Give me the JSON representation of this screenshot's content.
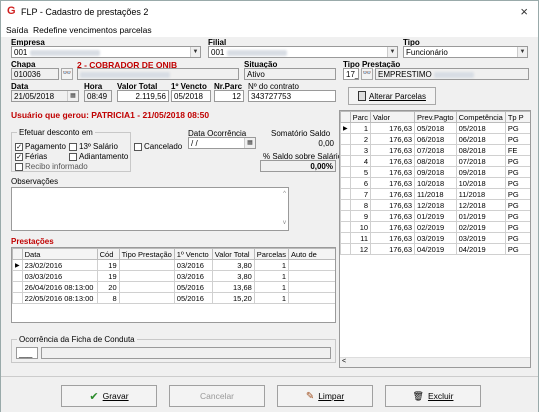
{
  "window": {
    "title": "FLP - Cadastro de prestações 2",
    "close": "×"
  },
  "menu": [
    "Saída",
    "Redefine vencimentos parcelas"
  ],
  "labels": {
    "empresa": "Empresa",
    "filial": "Filial",
    "tipo": "Tipo",
    "chapa": "Chapa",
    "collaborator": "2 - COBRADOR DE ONIB",
    "situacao": "Situação",
    "tipo_prestacao": "Tipo Prestação",
    "data": "Data",
    "hora": "Hora",
    "valor_total": "Valor Total",
    "primeiro_vencto": "1º Vencto",
    "nr_parc": "Nr.Parc",
    "n_contrato": "Nº do contrato",
    "usuario": "Usuário que gerou: PATRICIA1 - 21/05/2018 08:50",
    "desconto": "Efetuar desconto em",
    "pagamento": "Pagamento",
    "decimo": "13º Salário",
    "ferias": "Férias",
    "adiantamento": "Adiantamento",
    "recibo": "Recibo informado",
    "cancelado": "Cancelado",
    "data_ocorrencia": "Data Ocorrência",
    "somatorio_saldo": "Somatório Saldo",
    "perc_saldo": "% Saldo sobre Salário",
    "observacoes": "Observações",
    "prestacoes": "Prestações",
    "ocorrencia": "Ocorrência da Ficha de Conduta"
  },
  "values": {
    "empresa": "001",
    "filial": "001",
    "tipo": "Funcionário",
    "chapa": "010036",
    "situacao": "Ativo",
    "tipo_prestacao_code": "17_",
    "tipo_prestacao_name": "EMPRESTIMO",
    "data": "21/05/2018",
    "hora": "08:49",
    "valor_total": "2.119,56",
    "primeiro_vencto": "05/2018",
    "nr_parc": "12",
    "n_contrato": "343727753",
    "data_ocorrencia": "/ /",
    "somatorio": "0,00",
    "perc": "0,00%",
    "ocorrencia_code": "___"
  },
  "buttons": {
    "alterar": "Alterar Parcelas",
    "gravar": "Gravar",
    "cancelar": "Cancelar",
    "limpar": "Limpar",
    "excluir": "Excluir"
  },
  "prestacoes": {
    "headers": [
      "Data",
      "Cód",
      "Tipo Prestação",
      "1º Vencto",
      "Valor Total",
      "Parcelas",
      "Auto de"
    ],
    "rows": [
      [
        "23/02/2016",
        "19",
        "",
        "03/2016",
        "3,80",
        "1",
        ""
      ],
      [
        "03/03/2016",
        "19",
        "",
        "03/2016",
        "3,80",
        "1",
        ""
      ],
      [
        "26/04/2016 08:13:00",
        "20",
        "",
        "05/2016",
        "13,68",
        "1",
        ""
      ],
      [
        "22/05/2016 08:13:00",
        "8",
        "",
        "05/2016",
        "15,20",
        "1",
        ""
      ]
    ]
  },
  "parcelas": {
    "headers": [
      "Parc",
      "Valor",
      "Prev.Pagto",
      "Competência",
      "Tp P"
    ],
    "rows": [
      [
        "1",
        "176,63",
        "05/2018",
        "05/2018",
        "PG"
      ],
      [
        "2",
        "176,63",
        "06/2018",
        "06/2018",
        "PG"
      ],
      [
        "3",
        "176,63",
        "07/2018",
        "08/2018",
        "FE"
      ],
      [
        "4",
        "176,63",
        "08/2018",
        "07/2018",
        "PG"
      ],
      [
        "5",
        "176,63",
        "09/2018",
        "09/2018",
        "PG"
      ],
      [
        "6",
        "176,63",
        "10/2018",
        "10/2018",
        "PG"
      ],
      [
        "7",
        "176,63",
        "11/2018",
        "11/2018",
        "PG"
      ],
      [
        "8",
        "176,63",
        "12/2018",
        "12/2018",
        "PG"
      ],
      [
        "9",
        "176,63",
        "01/2019",
        "01/2019",
        "PG"
      ],
      [
        "10",
        "176,63",
        "02/2019",
        "02/2019",
        "PG"
      ],
      [
        "11",
        "176,63",
        "03/2019",
        "03/2019",
        "PG"
      ],
      [
        "12",
        "176,63",
        "04/2019",
        "04/2019",
        "PG"
      ]
    ]
  }
}
